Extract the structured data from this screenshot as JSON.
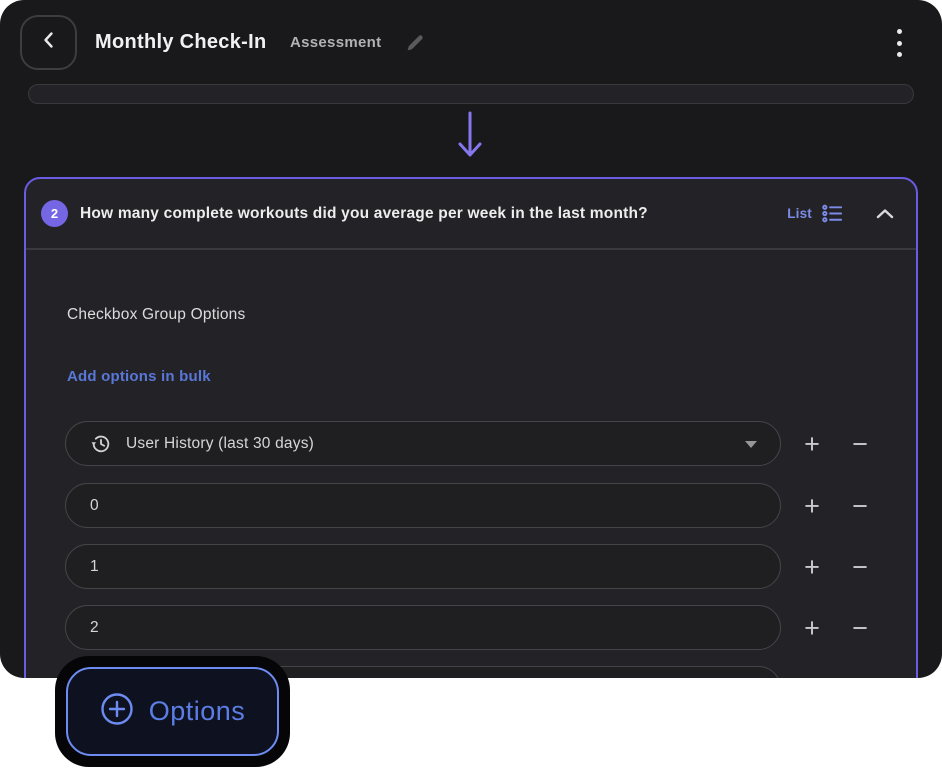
{
  "header": {
    "title": "Monthly Check-In",
    "subtitle": "Assessment"
  },
  "question": {
    "number": "2",
    "text": "How many complete workouts did you average per week in the last month?",
    "type_label": "List",
    "section_label": "Checkbox Group Options",
    "bulk_link": "Add options in bulk",
    "options": [
      {
        "value": "User History (last 30 days)"
      },
      {
        "value": "0"
      },
      {
        "value": "1"
      },
      {
        "value": "2"
      }
    ]
  },
  "stepper": {
    "increase_label": "+",
    "decrease_label": "−"
  },
  "options_button": {
    "label": "Options"
  },
  "icons": {
    "back": "chevron-left",
    "edit": "pencil",
    "menu": "kebab-vertical-dots",
    "question_type": "bulleted-list",
    "collapse": "chevron-up",
    "first_option": "history-clock",
    "dropdown": "caret-down",
    "options_button": "plus-circle"
  },
  "colors": {
    "window_bg": "#19191b",
    "card_bg": "#232327",
    "card_border_purple": "#6a5be3",
    "badge_purple": "#7566e4",
    "arrow_purple": "#8577ee",
    "type_label_blue": "#7d8be8",
    "link_blue": "#5877d6",
    "options_btn_border_blue": "#6d8bf0",
    "options_btn_text_blue": "#5d7de6",
    "highlight_ring": "#060608"
  }
}
